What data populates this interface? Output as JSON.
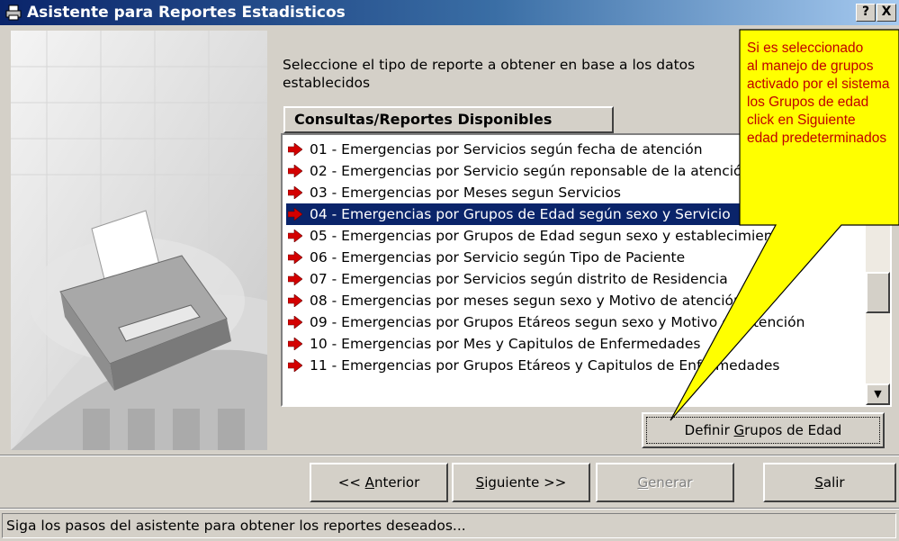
{
  "window": {
    "title": "Asistente para Reportes Estadisticos",
    "help_button": "?",
    "close_button": "X"
  },
  "instruction": "Seleccione el tipo de reporte a obtener en base a los datos establecidos",
  "list": {
    "header": "Consultas/Reportes Disponibles",
    "selected_index": 3,
    "items": [
      "01 - Emergencias por Servicios según fecha de atención",
      "02 - Emergencias por Servicio según reponsable de la atención",
      "03 - Emergencias por Meses segun Servicios",
      "04 - Emergencias por Grupos de Edad según sexo y Servicio",
      "05 - Emergencias por Grupos de Edad segun sexo y establecimiento",
      "06 - Emergencias por Servicio según Tipo de Paciente",
      "07 - Emergencias por Servicios según distrito de Residencia",
      "08 - Emergencias por meses segun sexo y Motivo de atención",
      "09 - Emergencias por Grupos Etáreos segun sexo y Motivo de Atención",
      "10 - Emergencias por Mes y Capitulos de Enfermedades",
      "11 - Emergencias por Grupos Etáreos y Capitulos de Enfermedades"
    ],
    "scroll_up": "▲",
    "scroll_down": "▼"
  },
  "buttons": {
    "define_age_groups": {
      "pre": "Definir ",
      "key": "G",
      "post": "rupos de Edad"
    },
    "previous": {
      "pre": "<< ",
      "key": "A",
      "post": "nterior"
    },
    "next": {
      "pre": "",
      "key": "S",
      "post": "iguiente >>"
    },
    "generate": {
      "pre": "",
      "key": "G",
      "post": "enerar"
    },
    "exit": {
      "pre": "",
      "key": "S",
      "post": "alir"
    }
  },
  "callout": {
    "lines": [
      "Si es seleccionado",
      "al manejo de grupos",
      "activado por el sistema",
      "los Grupos de edad",
      "click en Siguiente",
      "edad predeterminados"
    ],
    "fill": "#ffff00",
    "text_color": "#c00000"
  },
  "status": "Siga los pasos del asistente para obtener los reportes deseados...",
  "colors": {
    "title_start": "#0a246a",
    "title_end": "#a6caf0",
    "selection": "#0a246a",
    "arrow": "#d40000"
  }
}
